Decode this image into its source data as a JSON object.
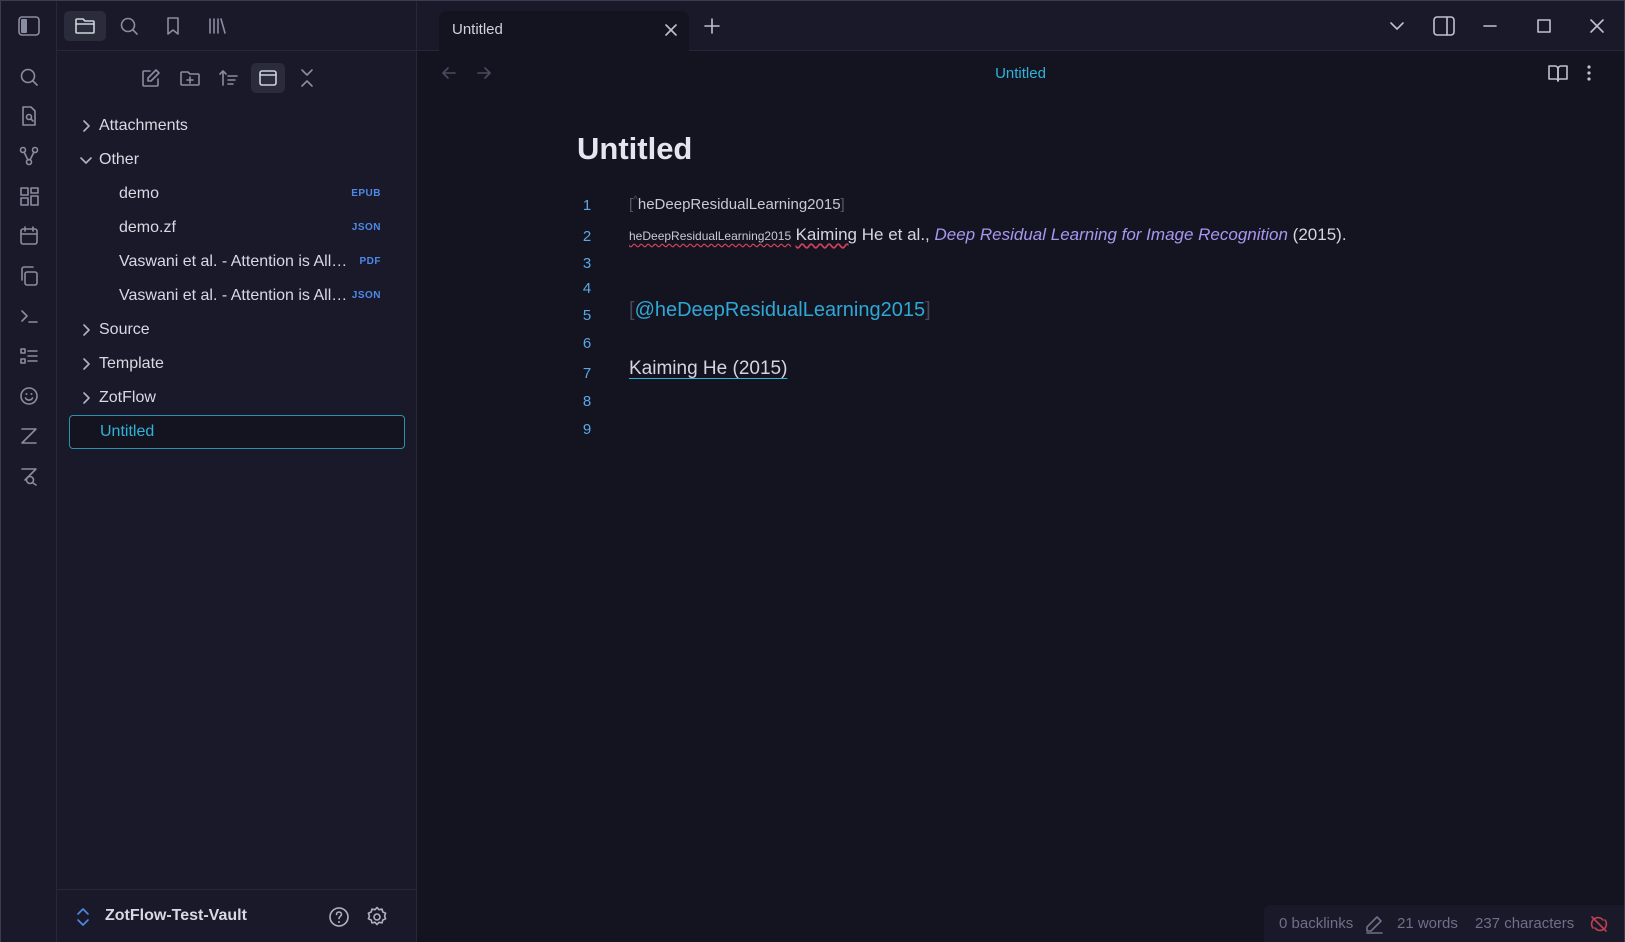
{
  "colors": {
    "accent": "#2fb3d9",
    "background": "#141420",
    "panel": "#19192a",
    "tag": "#4d8ae8",
    "link_italic": "#a896f0"
  },
  "sidebar_tabs": [
    "files-icon",
    "search-icon",
    "bookmark-icon",
    "library-icon"
  ],
  "tree": {
    "folders": {
      "attachments": "Attachments",
      "other": "Other",
      "source": "Source",
      "template": "Template",
      "zotflow": "ZotFlow"
    },
    "files": [
      {
        "name": "demo",
        "tag": "EPUB"
      },
      {
        "name": "demo.zf",
        "tag": "JSON"
      },
      {
        "name": "Vaswani et al. - Attention is All You Need",
        "tag": "PDF"
      },
      {
        "name": "Vaswani et al. - Attention is All You Need",
        "tag": "JSON"
      }
    ],
    "selected": "Untitled"
  },
  "vault": {
    "name": "ZotFlow-Test-Vault"
  },
  "tab": {
    "title": "Untitled"
  },
  "view": {
    "title": "Untitled"
  },
  "note": {
    "title": "Untitled",
    "line_numbers": [
      "1",
      "2",
      "3",
      "4",
      "5",
      "6",
      "7",
      "8",
      "9"
    ],
    "line1": {
      "open": "[",
      "caret": "^",
      "key": "heDeepResidualLearning2015",
      "close": "]"
    },
    "line2": {
      "ref": "heDeepResidualLearning2015",
      "author_a": "Kaiming",
      "author_b": " He et al., ",
      "work": "Deep Residual Learning for Image Recognition",
      "year": " (2015)."
    },
    "line5": {
      "open": "[",
      "cite": "@heDeepResidualLearning2015",
      "close": "]"
    },
    "line7": {
      "citation": "Kaiming He (2015)"
    }
  },
  "status": {
    "backlinks": "0 backlinks",
    "words": "21 words",
    "characters": "237 characters"
  }
}
